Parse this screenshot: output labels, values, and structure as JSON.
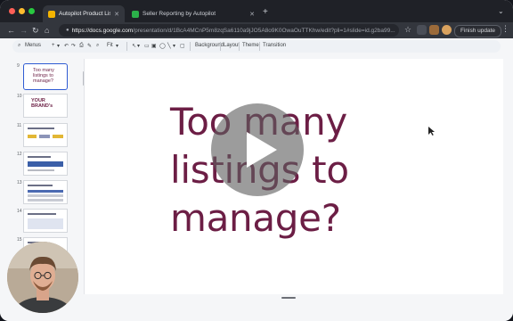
{
  "browser": {
    "tabs": [
      {
        "label": "Autopilot Product Listing AI",
        "favicon_color": "#f4b400",
        "active": true
      },
      {
        "label": "Seller Reporting by Autopilot",
        "favicon_color": "#2bb04a",
        "active": false
      }
    ],
    "new_tab_label": "+",
    "url": {
      "host": "https://docs.google.com",
      "path": "/presentation/d/1BcA4MCnP5m8zqSa6110a9jJO5A8o9K0OwaOuTTKhw/edit?pli=1#slide=id.g2ba99..."
    },
    "finish_update_label": "Finish update",
    "traffic_colors": [
      "#ff5f57",
      "#febc2e",
      "#28c840"
    ]
  },
  "slides_toolbar": {
    "menus_label": "Menus",
    "zoom_label": "Fit",
    "background_label": "Background",
    "layout_label": "Layout",
    "theme_label": "Theme",
    "transition_label": "Transition"
  },
  "filmstrip": {
    "slides": [
      {
        "number": "9",
        "text": "Too many listings to manage?",
        "selected": true
      },
      {
        "number": "10",
        "text": "YOUR BRAND's",
        "selected": false
      },
      {
        "number": "11",
        "text": "",
        "selected": false
      },
      {
        "number": "12",
        "text": "",
        "selected": false
      },
      {
        "number": "13",
        "text": "",
        "selected": false
      },
      {
        "number": "14",
        "text": "",
        "selected": false
      },
      {
        "number": "15",
        "text": "",
        "selected": false
      }
    ]
  },
  "slide": {
    "title_lines": [
      "Too many",
      "listings to",
      "manage?"
    ],
    "title_color": "#6c1e45"
  },
  "icons": [
    "back-icon",
    "forward-icon",
    "reload-icon",
    "lock-icon",
    "play-icon",
    "mouse-cursor-icon",
    "webcam-presenter"
  ]
}
